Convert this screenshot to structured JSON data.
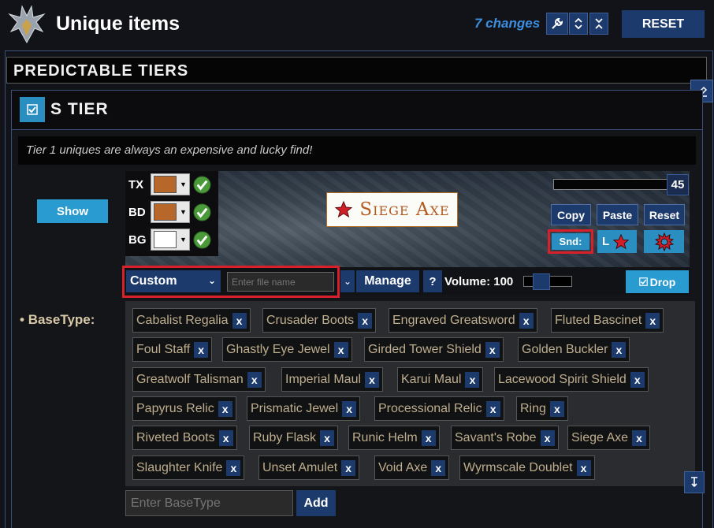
{
  "header": {
    "title": "Unique items",
    "changes": "7 changes",
    "reset_label": "RESET"
  },
  "section": {
    "title": "PREDICTABLE TIERS"
  },
  "tier": {
    "title": "S TIER",
    "description": "Tier 1 uniques are always an expensive and lucky find!",
    "show_label": "Show"
  },
  "preview": {
    "text_label": "TX",
    "border_label": "BD",
    "background_label": "BG",
    "text_color": "#b8672a",
    "border_color": "#b8672a",
    "background_color": "#ffffff",
    "item_name": "Siege Axe",
    "font_size": "45",
    "copy_label": "Copy",
    "paste_label": "Paste",
    "reset_label": "Reset",
    "sound_label": "Snd:",
    "l_label": "L"
  },
  "sound": {
    "mode": "Custom",
    "file_placeholder": "Enter file name",
    "manage_label": "Manage",
    "help_label": "?",
    "volume_label": "Volume: 100",
    "drop_label": "Drop"
  },
  "basetype": {
    "label": "BaseType:",
    "remove_label": "x",
    "items": [
      "Cabalist Regalia",
      "Crusader Boots",
      "Engraved Greatsword",
      "Fluted Bascinet",
      "Foul Staff",
      "Ghastly Eye Jewel",
      "Girded Tower Shield",
      "Golden Buckler",
      "Greatwolf Talisman",
      "Imperial Maul",
      "Karui Maul",
      "Lacewood Spirit Shield",
      "Papyrus Relic",
      "Prismatic Jewel",
      "Processional Relic",
      "Ring",
      "Riveted Boots",
      "Ruby Flask",
      "Runic Helm",
      "Savant's Robe",
      "Siege Axe",
      "Slaughter Knife",
      "Unset Amulet",
      "Void Axe",
      "Wyrmscale Doublet"
    ],
    "input_placeholder": "Enter BaseType",
    "add_label": "Add"
  }
}
